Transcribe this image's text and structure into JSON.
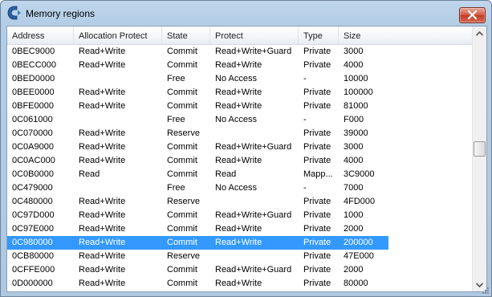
{
  "window": {
    "title": "Memory regions",
    "accent_close": "#c8442c"
  },
  "columns": [
    "Address",
    "Allocation Protect",
    "State",
    "Protect",
    "Type",
    "Size"
  ],
  "rows": [
    [
      "0BEC9000",
      "Read+Write",
      "Commit",
      "Read+Write+Guard",
      "Private",
      "3000"
    ],
    [
      "0BECC000",
      "Read+Write",
      "Commit",
      "Read+Write",
      "Private",
      "4000"
    ],
    [
      "0BED0000",
      "",
      "Free",
      "No Access",
      "-",
      "10000"
    ],
    [
      "0BEE0000",
      "Read+Write",
      "Commit",
      "Read+Write",
      "Private",
      "100000"
    ],
    [
      "0BFE0000",
      "Read+Write",
      "Commit",
      "Read+Write",
      "Private",
      "81000"
    ],
    [
      "0C061000",
      "",
      "Free",
      "No Access",
      "-",
      "F000"
    ],
    [
      "0C070000",
      "Read+Write",
      "Reserve",
      "",
      "Private",
      "39000"
    ],
    [
      "0C0A9000",
      "Read+Write",
      "Commit",
      "Read+Write+Guard",
      "Private",
      "3000"
    ],
    [
      "0C0AC000",
      "Read+Write",
      "Commit",
      "Read+Write",
      "Private",
      "4000"
    ],
    [
      "0C0B0000",
      "Read",
      "Commit",
      "Read",
      "Mapp...",
      "3C9000"
    ],
    [
      "0C479000",
      "",
      "Free",
      "No Access",
      "-",
      "7000"
    ],
    [
      "0C480000",
      "Read+Write",
      "Reserve",
      "",
      "Private",
      "4FD000"
    ],
    [
      "0C97D000",
      "Read+Write",
      "Commit",
      "Read+Write+Guard",
      "Private",
      "1000"
    ],
    [
      "0C97E000",
      "Read+Write",
      "Commit",
      "Read+Write",
      "Private",
      "2000"
    ],
    [
      "0C980000",
      "Read+Write",
      "Commit",
      "Read+Write",
      "Private",
      "200000"
    ],
    [
      "0CB80000",
      "Read+Write",
      "Reserve",
      "",
      "Private",
      "47E000"
    ],
    [
      "0CFFE000",
      "Read+Write",
      "Commit",
      "Read+Write+Guard",
      "Private",
      "2000"
    ],
    [
      "0D000000",
      "Read+Write",
      "Commit",
      "Read+Write",
      "Private",
      "80000"
    ]
  ],
  "selected_row_index": 14,
  "selection_color": "#3399ff",
  "icons": {
    "app": "cheat-engine-icon",
    "close": "close-icon",
    "scroll_up": "chevron-up-icon",
    "scroll_down": "chevron-down-icon",
    "grip": "resize-grip-icon"
  }
}
